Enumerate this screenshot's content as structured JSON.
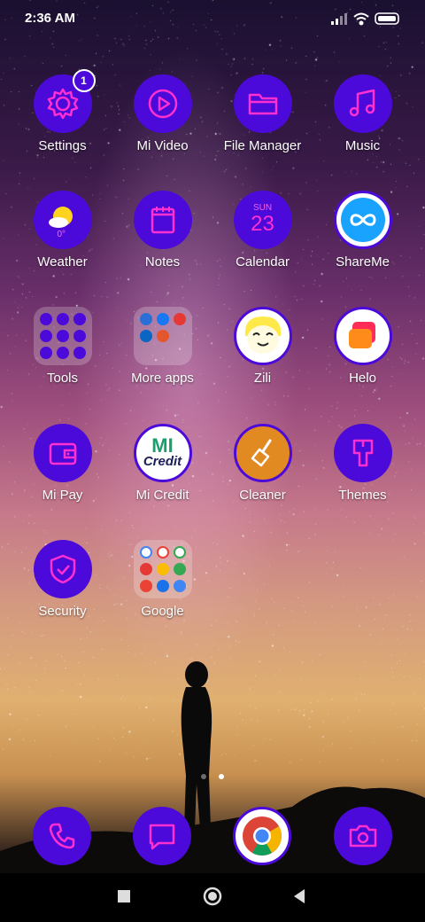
{
  "status_bar": {
    "time": "2:36 AM"
  },
  "accent_color": "#4b0ad9",
  "icon_color": "#ff2fd0",
  "apps": [
    {
      "label": "Settings",
      "icon": "gear-icon",
      "badge": "1"
    },
    {
      "label": "Mi Video",
      "icon": "play-icon"
    },
    {
      "label": "File Manager",
      "icon": "folder-icon"
    },
    {
      "label": "Music",
      "icon": "music-note-icon"
    },
    {
      "label": "Weather",
      "icon": "weather-icon",
      "temp": "0°"
    },
    {
      "label": "Notes",
      "icon": "notepad-icon"
    },
    {
      "label": "Calendar",
      "icon": "calendar-icon",
      "day": "SUN",
      "date": "23"
    },
    {
      "label": "ShareMe",
      "icon": "infinity-icon"
    },
    {
      "label": "Tools",
      "icon": "tools-folder-icon"
    },
    {
      "label": "More apps",
      "icon": "more-apps-folder-icon"
    },
    {
      "label": "Zili",
      "icon": "zili-face-icon"
    },
    {
      "label": "Helo",
      "icon": "helo-chat-icon"
    },
    {
      "label": "Mi Pay",
      "icon": "wallet-icon"
    },
    {
      "label": "Mi Credit",
      "icon": "mi-credit-logo-icon",
      "logo_top": "MI",
      "logo_bottom": "Credit"
    },
    {
      "label": "Cleaner",
      "icon": "broom-icon"
    },
    {
      "label": "Themes",
      "icon": "paintbrush-icon"
    },
    {
      "label": "Security",
      "icon": "shield-check-icon"
    },
    {
      "label": "Google",
      "icon": "google-folder-icon"
    }
  ],
  "dock": [
    {
      "icon": "phone-icon"
    },
    {
      "icon": "message-icon"
    },
    {
      "icon": "chrome-icon"
    },
    {
      "icon": "camera-icon"
    }
  ],
  "page_indicator": {
    "pages": 2,
    "current": 2
  },
  "nav": [
    "recents-button",
    "home-button",
    "back-button"
  ]
}
